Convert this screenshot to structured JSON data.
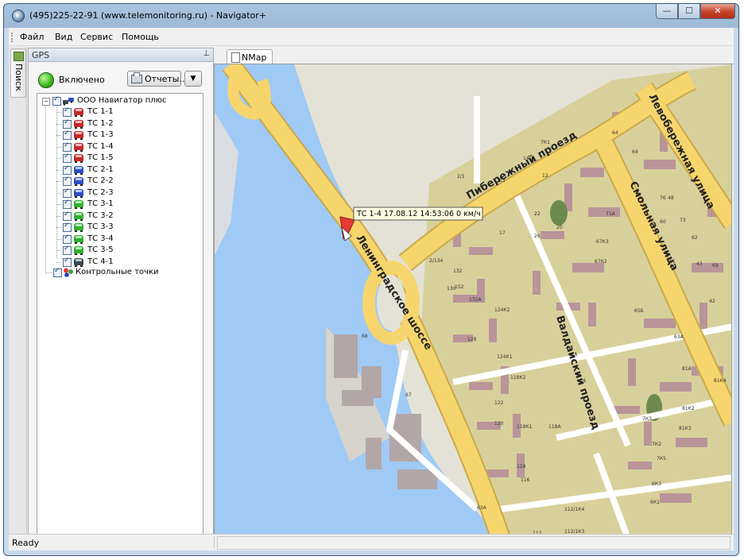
{
  "window": {
    "title": "(495)225-22-91  (www.telemonitoring.ru) - Navigator+",
    "buttons": {
      "minimize": "—",
      "maximize": "☐",
      "close": "✕"
    }
  },
  "menu": [
    "Файл",
    "Вид",
    "Сервис",
    "Помощь"
  ],
  "side_tab": {
    "label": "Поиск"
  },
  "gps_panel": {
    "title": "GPS",
    "status": "Включено",
    "reports_button": "Отчеты...",
    "dropdown_arrow": "▼",
    "tree": {
      "root": "ООО Навигатор плюс",
      "vehicles": [
        {
          "label": "ТС 1-1",
          "color": "red"
        },
        {
          "label": "ТС 1-2",
          "color": "red"
        },
        {
          "label": "ТС 1-3",
          "color": "red"
        },
        {
          "label": "ТС 1-4",
          "color": "red"
        },
        {
          "label": "ТС 1-5",
          "color": "red"
        },
        {
          "label": "ТС 2-1",
          "color": "blue"
        },
        {
          "label": "ТС 2-2",
          "color": "blue"
        },
        {
          "label": "ТС 2-3",
          "color": "blue"
        },
        {
          "label": "ТС 3-1",
          "color": "green"
        },
        {
          "label": "ТС 3-2",
          "color": "green"
        },
        {
          "label": "ТС 3-3",
          "color": "green"
        },
        {
          "label": "ТС 3-4",
          "color": "green"
        },
        {
          "label": "ТС 3-5",
          "color": "green"
        },
        {
          "label": "ТС 4-1",
          "color": "dark"
        }
      ],
      "checkpoints": "Контрольные точки"
    }
  },
  "map_tab": {
    "label": "NMap"
  },
  "map": {
    "tooltip": "ТС 1-4 17.08.12 14:53:06  0 км/ч",
    "streets": {
      "leningradskoe": "Ленинградское шоссе",
      "beregovoy": "Пибережный проезд",
      "valdaisky": "Валдайский проезд",
      "smolnaya": "Смольная улица",
      "levoberezhnaya": "Левобережная улица"
    },
    "house_numbers": [
      "7К1",
      "64",
      "14",
      "12",
      "2/1",
      "13",
      "20",
      "22",
      "26",
      "71А",
      "76",
      "73",
      "61",
      "17",
      "2/134",
      "132",
      "152",
      "130",
      "132А",
      "128",
      "124К2",
      "124К1",
      "122",
      "120",
      "118К2",
      "118К1",
      "118А",
      "118",
      "116",
      "112/1К4",
      "112/1К3",
      "112",
      "67",
      "68",
      "63А",
      "65Б",
      "63А",
      "81А",
      "81К2",
      "81К3",
      "81К4",
      "7К3",
      "7К2",
      "7К5",
      "6К3",
      "6К1",
      "43",
      "48",
      "69",
      "60",
      "62",
      "42",
      "40",
      "67К3",
      "67К2",
      "64"
    ]
  },
  "statusbar": {
    "text": "Ready"
  }
}
